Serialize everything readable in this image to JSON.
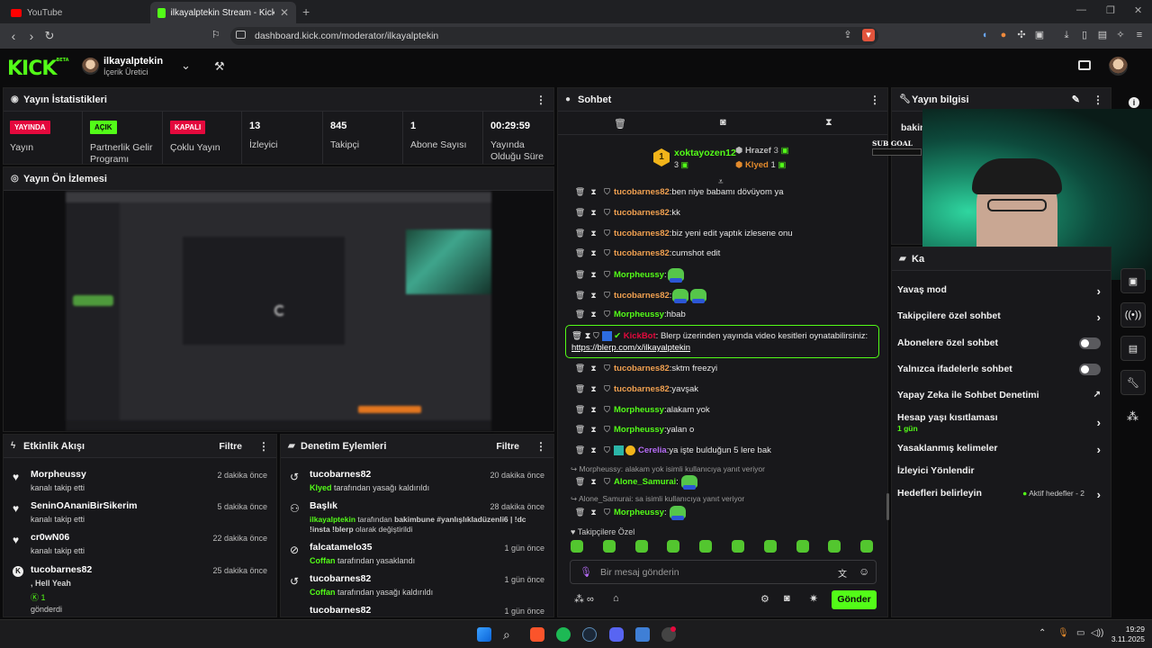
{
  "browser": {
    "tabs": [
      {
        "label": "YouTube",
        "active": false
      },
      {
        "label": "ilkayalptekin Stream - Kick Dashb",
        "active": true
      }
    ],
    "url": "dashboard.kick.com/moderator/ilkayalptekin",
    "icons": [
      "back-icon",
      "forward-icon",
      "reload-icon",
      "bookmark-icon",
      "share-icon",
      "brave-shield-icon",
      "download-icon",
      "sidebar-icon",
      "wallet-icon",
      "leo-icon",
      "menu-icon"
    ]
  },
  "header": {
    "logo": "KICK",
    "logo_sup": "BETA",
    "username": "ilkayalptekin",
    "role": "İçerik Üretici"
  },
  "stats": {
    "title": "Yayın İstatistikleri",
    "items": [
      {
        "badge": "YAYINDA",
        "label": "Yayın"
      },
      {
        "badge": "AÇIK",
        "label": "Partnerlik Gelir Programı"
      },
      {
        "badge": "KAPALI",
        "label": "Çoklu Yayın"
      },
      {
        "value": "13",
        "label": "İzleyici"
      },
      {
        "value": "845",
        "label": "Takipçi"
      },
      {
        "value": "1",
        "label": "Abone Sayısı"
      },
      {
        "value": "00:29:59",
        "label": "Yayında Olduğu Süre"
      }
    ],
    "badge_colors": {
      "live": "#e4093d",
      "on": "#53fc18",
      "off": "#e4093d"
    }
  },
  "preview": {
    "title": "Yayın Ön İzlemesi"
  },
  "activity": {
    "title": "Etkinlik Akışı",
    "filter": "Filtre",
    "rows": [
      {
        "user": "Morpheussy",
        "text": "kanalı takip etti",
        "time": "2 dakika önce"
      },
      {
        "user": "SeninOAnaniBirSikerim",
        "text": "kanalı takip etti",
        "time": "5 dakika önce"
      },
      {
        "user": "cr0wN06",
        "text": "kanalı takip etti",
        "time": "22 dakika önce"
      },
      {
        "user": "tucobarnes82",
        "text": ", Hell Yeah",
        "count": "1",
        "text2": "gönderdi",
        "time": "25 dakika önce"
      }
    ]
  },
  "moderation": {
    "title": "Denetim Eylemleri",
    "filter": "Filtre",
    "rows": [
      {
        "user": "tucobarnes82",
        "actor": "Klyed",
        "text": "tarafından yasağı kaldırıldı",
        "time": "20 dakika önce"
      },
      {
        "user": "Başlık",
        "actor": "ilkayalptekin",
        "text": "tarafından",
        "title": "bakimbune #yanlışlıkladüzenli6 | !dc !insta !blerp",
        "text2": "olarak değiştirildi",
        "time": "28 dakika önce"
      },
      {
        "user": "falcatamelo35",
        "actor": "Coffan",
        "text": "tarafından yasaklandı",
        "time": "1 gün önce"
      },
      {
        "user": "tucobarnes82",
        "actor": "Coffan",
        "text": "tarafından yasağı kaldırıldı",
        "time": "1 gün önce"
      },
      {
        "user": "tucobarnes82",
        "actor": "",
        "text": "",
        "time": "1 gün önce"
      }
    ]
  },
  "chat": {
    "title": "Sohbet",
    "leaderboard": [
      {
        "rank": "1",
        "user": "xoktayozen12",
        "count": "3"
      },
      {
        "user": "Hrazef",
        "count": "3"
      },
      {
        "user": "Klyed",
        "count": "1"
      }
    ],
    "messages": [
      {
        "user": "tucobarnes82",
        "color": "#f0a050",
        "text": "ben niye babamı dövüyom ya"
      },
      {
        "user": "tucobarnes82",
        "color": "#f0a050",
        "text": "kk"
      },
      {
        "user": "tucobarnes82",
        "color": "#f0a050",
        "text": "biz yeni edit yaptık izlesene onu"
      },
      {
        "user": "tucobarnes82",
        "color": "#f0a050",
        "text": "cumshot edit"
      },
      {
        "user": "Morpheussy",
        "color": "#53fc18",
        "text": "",
        "emotes": 1
      },
      {
        "user": "tucobarnes82",
        "color": "#f0a050",
        "text": "",
        "emotes": 2
      },
      {
        "user": "Morpheussy",
        "color": "#53fc18",
        "text": "hbab"
      },
      {
        "user": "tucobarnes82",
        "color": "#f0a050",
        "text": "sktm freezyi"
      },
      {
        "user": "tucobarnes82",
        "color": "#f0a050",
        "text": "yavşak"
      },
      {
        "user": "Morpheussy",
        "color": "#53fc18",
        "text": "alakam yok"
      },
      {
        "user": "Morpheussy",
        "color": "#53fc18",
        "text": "yalan o"
      },
      {
        "user": "Cerelia",
        "color": "#b56cf5",
        "text": "ya işte bulduğun 5 lere bak"
      }
    ],
    "bot": {
      "user": "KickBot",
      "text": "Blerp üzerinden yayında video kesitleri oynatabilirsiniz:",
      "link": "https://blerp.com/x/ilkayalptekin"
    },
    "reply1": "Morpheussy: alakam yok isimli kullanıcıya yanıt veriyor",
    "reply1_user": "Alone_Samurai",
    "reply2": "Alone_Samurai: sa isimli kullanıcıya yanıt veriyor",
    "reply2_user": "Morpheussy",
    "followers_only": "Takipçilere Özel",
    "input_placeholder": "Bir mesaj gönderin",
    "send": "Gönder"
  },
  "info": {
    "title": "Yayın bilgisi",
    "stream_title": "bakim",
    "sub_goal": "SUB GOAL"
  },
  "settings": {
    "title": "Ka",
    "rows": [
      {
        "label": "Yavaş mod",
        "control": "chevron"
      },
      {
        "label": "Takipçilere özel sohbet",
        "control": "chevron"
      },
      {
        "label": "Abonelere özel sohbet",
        "control": "toggle"
      },
      {
        "label": "Yalnızca ifadelerle sohbet",
        "control": "toggle"
      },
      {
        "label": "Yapay Zeka ile Sohbet Denetimi",
        "control": "external"
      },
      {
        "label": "Hesap yaşı kısıtlaması",
        "sub": "1 gün",
        "control": "chevron"
      },
      {
        "label": "Yasaklanmış kelimeler",
        "control": "chevron"
      },
      {
        "label": "İzleyici Yönlendir",
        "control": "none"
      },
      {
        "label": "Hedefleri belirleyin",
        "extra": "Aktif hedefler - 2",
        "control": "chevron"
      }
    ]
  },
  "taskbar": {
    "time": "19:29",
    "date": "3.11.2025"
  }
}
